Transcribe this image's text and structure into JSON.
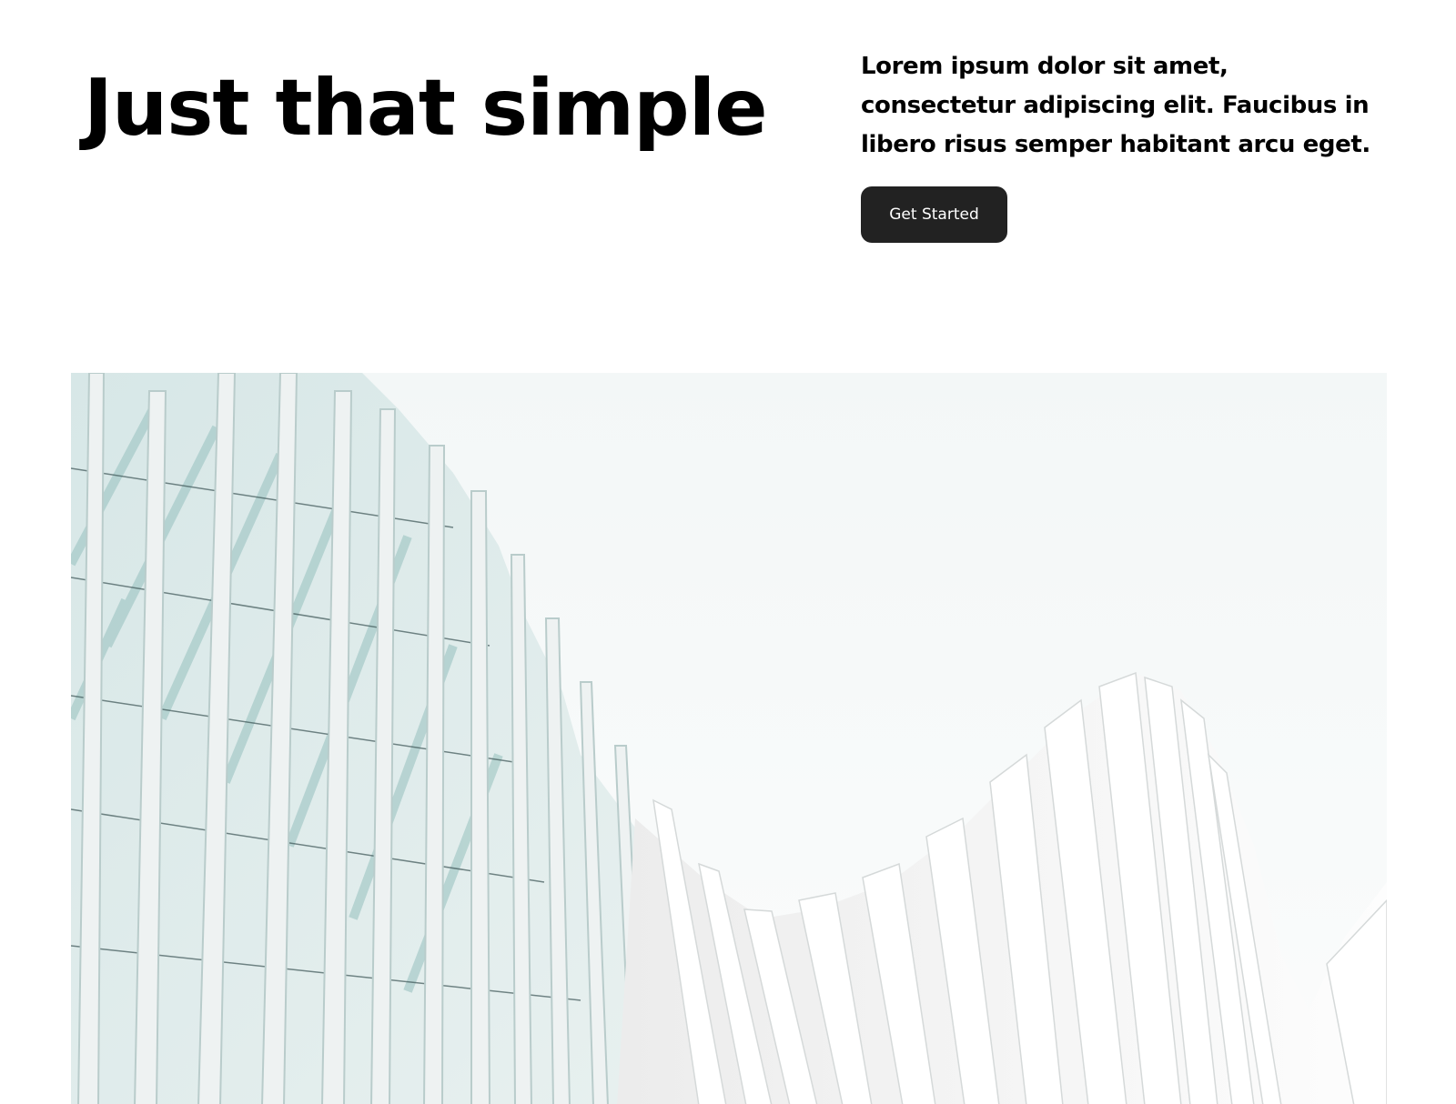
{
  "hero": {
    "title": "Just that simple",
    "description": "Lorem ipsum dolor sit amet, consectetur adipiscing elit. Faucibus in libero risus semper habitant arcu eget.",
    "cta_label": "Get Started"
  },
  "colors": {
    "background": "#ffffff",
    "text": "#000000",
    "button_bg": "#222222",
    "button_text": "#ffffff"
  }
}
